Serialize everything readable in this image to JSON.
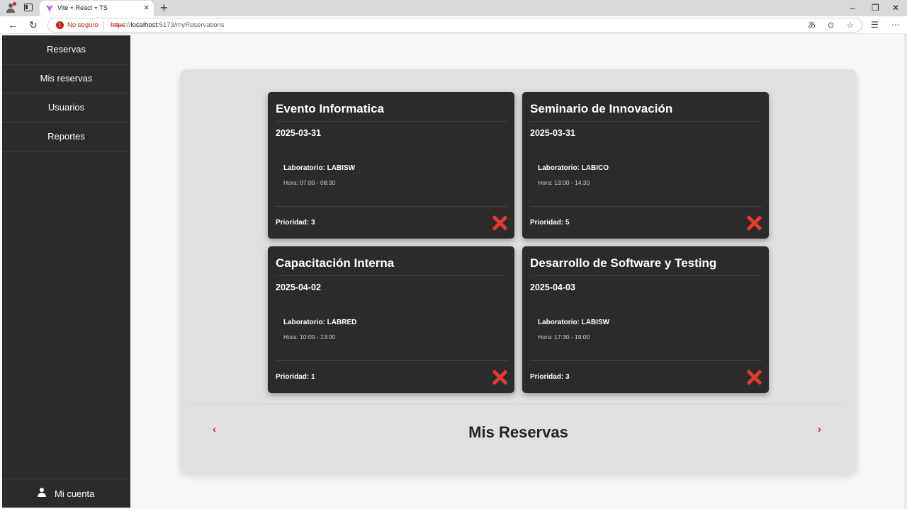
{
  "browser": {
    "tab_title": "Vite + React + TS",
    "security_label": "No seguro",
    "url_protocol": "https",
    "url_separator": "://",
    "url_host": "localhost",
    "url_rest": ":5173/myReservations"
  },
  "sidebar": {
    "items": [
      {
        "label": "Reservas"
      },
      {
        "label": "Mis reservas"
      },
      {
        "label": "Usuarios"
      },
      {
        "label": "Reportes"
      }
    ],
    "account_label": "Mi cuenta"
  },
  "reservations": [
    {
      "title": "Evento Informatica",
      "date": "2025-03-31",
      "lab": "Laboratorio: LABISW",
      "time": "Hora: 07:00 - 08:30",
      "priority": "Prioridad: 3"
    },
    {
      "title": "Seminario de Innovación",
      "date": "2025-03-31",
      "lab": "Laboratorio: LABICO",
      "time": "Hora: 13:00 - 14:30",
      "priority": "Prioridad: 5"
    },
    {
      "title": "Capacitación Interna",
      "date": "2025-04-02",
      "lab": "Laboratorio: LABRED",
      "time": "Hora: 10:00 - 13:00",
      "priority": "Prioridad: 1"
    },
    {
      "title": "Desarrollo de Software y Testing",
      "date": "2025-04-03",
      "lab": "Laboratorio: LABISW",
      "time": "Hora: 17:30 - 19:00",
      "priority": "Prioridad: 3"
    }
  ],
  "pager": {
    "prev": "‹",
    "next": "›",
    "title": "Mis Reservas"
  },
  "colors": {
    "sidebar_bg": "#2b2b2b",
    "card_bg": "#2b2b2b",
    "delete_red": "#e53935",
    "panel_bg": "#e0e0e0"
  }
}
